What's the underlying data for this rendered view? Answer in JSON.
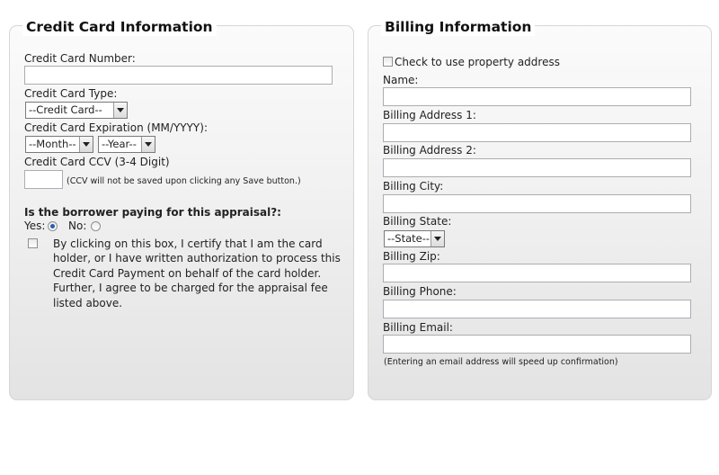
{
  "credit_card": {
    "title": "Credit Card Information",
    "number_label": "Credit Card Number:",
    "number_value": "",
    "type_label": "Credit Card Type:",
    "type_selected": "--Credit Card--",
    "expiration_label": "Credit Card Expiration (MM/YYYY):",
    "month_selected": "--Month--",
    "year_selected": "--Year--",
    "ccv_label": "Credit Card CCV (3-4 Digit)",
    "ccv_value": "",
    "ccv_note": "(CCV will not be saved upon clicking any Save button.)",
    "borrower_question": "Is the borrower paying for this appraisal?:",
    "yes_label": "Yes:",
    "no_label": "No:",
    "yes_checked": true,
    "certify_text": "By clicking on this box, I certify that I am the card holder, or I have written authorization to process this Credit Card Payment on behalf of the card holder. Further, I agree to be charged for the appraisal fee listed above."
  },
  "billing": {
    "title": "Billing Information",
    "use_property_address_label": "Check to use property address",
    "name_label": "Name:",
    "address1_label": "Billing Address 1:",
    "address2_label": "Billing Address 2:",
    "city_label": "Billing City:",
    "state_label": "Billing State:",
    "state_selected": "--State--",
    "zip_label": "Billing Zip:",
    "phone_label": "Billing Phone:",
    "email_label": "Billing Email:",
    "email_note": "(Entering an email address will speed up confirmation)"
  }
}
